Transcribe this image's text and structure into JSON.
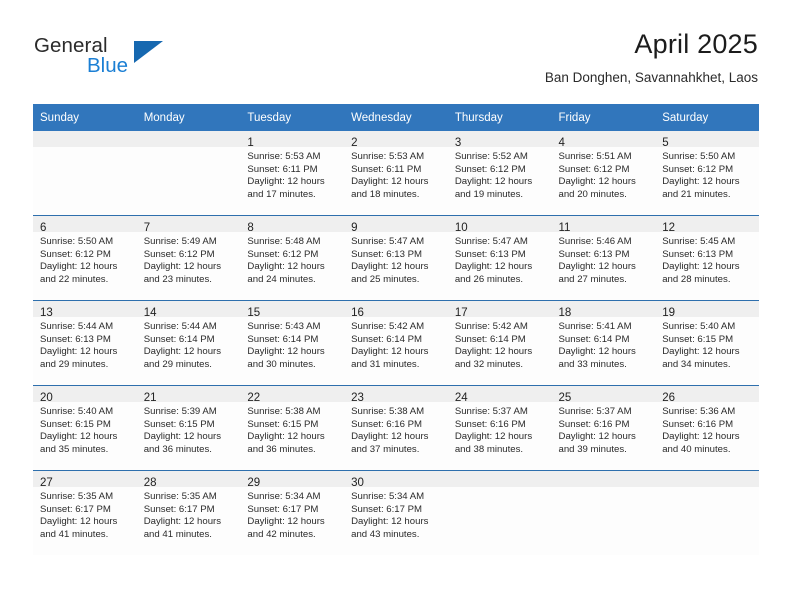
{
  "logo": {
    "word_one": "General",
    "word_two": "Blue",
    "flag_icon": "blue-triangle-flag-icon"
  },
  "header": {
    "title": "April 2025",
    "subtitle": "Ban Donghen, Savannahkhet, Laos"
  },
  "colors": {
    "header_blue": "#3176bc",
    "divider_blue": "#2e6fad",
    "daynum_band": "#efefef",
    "logo_blue": "#1b7fd4",
    "logo_flag": "#1668b0"
  },
  "calendar": {
    "weekday_headers": [
      "Sunday",
      "Monday",
      "Tuesday",
      "Wednesday",
      "Thursday",
      "Friday",
      "Saturday"
    ],
    "weeks": [
      [
        {
          "day": "",
          "sunrise": "",
          "sunset": "",
          "daylight_line1": "",
          "daylight_line2": ""
        },
        {
          "day": "",
          "sunrise": "",
          "sunset": "",
          "daylight_line1": "",
          "daylight_line2": ""
        },
        {
          "day": "1",
          "sunrise": "Sunrise: 5:53 AM",
          "sunset": "Sunset: 6:11 PM",
          "daylight_line1": "Daylight: 12 hours",
          "daylight_line2": "and 17 minutes."
        },
        {
          "day": "2",
          "sunrise": "Sunrise: 5:53 AM",
          "sunset": "Sunset: 6:11 PM",
          "daylight_line1": "Daylight: 12 hours",
          "daylight_line2": "and 18 minutes."
        },
        {
          "day": "3",
          "sunrise": "Sunrise: 5:52 AM",
          "sunset": "Sunset: 6:12 PM",
          "daylight_line1": "Daylight: 12 hours",
          "daylight_line2": "and 19 minutes."
        },
        {
          "day": "4",
          "sunrise": "Sunrise: 5:51 AM",
          "sunset": "Sunset: 6:12 PM",
          "daylight_line1": "Daylight: 12 hours",
          "daylight_line2": "and 20 minutes."
        },
        {
          "day": "5",
          "sunrise": "Sunrise: 5:50 AM",
          "sunset": "Sunset: 6:12 PM",
          "daylight_line1": "Daylight: 12 hours",
          "daylight_line2": "and 21 minutes."
        }
      ],
      [
        {
          "day": "6",
          "sunrise": "Sunrise: 5:50 AM",
          "sunset": "Sunset: 6:12 PM",
          "daylight_line1": "Daylight: 12 hours",
          "daylight_line2": "and 22 minutes."
        },
        {
          "day": "7",
          "sunrise": "Sunrise: 5:49 AM",
          "sunset": "Sunset: 6:12 PM",
          "daylight_line1": "Daylight: 12 hours",
          "daylight_line2": "and 23 minutes."
        },
        {
          "day": "8",
          "sunrise": "Sunrise: 5:48 AM",
          "sunset": "Sunset: 6:12 PM",
          "daylight_line1": "Daylight: 12 hours",
          "daylight_line2": "and 24 minutes."
        },
        {
          "day": "9",
          "sunrise": "Sunrise: 5:47 AM",
          "sunset": "Sunset: 6:13 PM",
          "daylight_line1": "Daylight: 12 hours",
          "daylight_line2": "and 25 minutes."
        },
        {
          "day": "10",
          "sunrise": "Sunrise: 5:47 AM",
          "sunset": "Sunset: 6:13 PM",
          "daylight_line1": "Daylight: 12 hours",
          "daylight_line2": "and 26 minutes."
        },
        {
          "day": "11",
          "sunrise": "Sunrise: 5:46 AM",
          "sunset": "Sunset: 6:13 PM",
          "daylight_line1": "Daylight: 12 hours",
          "daylight_line2": "and 27 minutes."
        },
        {
          "day": "12",
          "sunrise": "Sunrise: 5:45 AM",
          "sunset": "Sunset: 6:13 PM",
          "daylight_line1": "Daylight: 12 hours",
          "daylight_line2": "and 28 minutes."
        }
      ],
      [
        {
          "day": "13",
          "sunrise": "Sunrise: 5:44 AM",
          "sunset": "Sunset: 6:13 PM",
          "daylight_line1": "Daylight: 12 hours",
          "daylight_line2": "and 29 minutes."
        },
        {
          "day": "14",
          "sunrise": "Sunrise: 5:44 AM",
          "sunset": "Sunset: 6:14 PM",
          "daylight_line1": "Daylight: 12 hours",
          "daylight_line2": "and 29 minutes."
        },
        {
          "day": "15",
          "sunrise": "Sunrise: 5:43 AM",
          "sunset": "Sunset: 6:14 PM",
          "daylight_line1": "Daylight: 12 hours",
          "daylight_line2": "and 30 minutes."
        },
        {
          "day": "16",
          "sunrise": "Sunrise: 5:42 AM",
          "sunset": "Sunset: 6:14 PM",
          "daylight_line1": "Daylight: 12 hours",
          "daylight_line2": "and 31 minutes."
        },
        {
          "day": "17",
          "sunrise": "Sunrise: 5:42 AM",
          "sunset": "Sunset: 6:14 PM",
          "daylight_line1": "Daylight: 12 hours",
          "daylight_line2": "and 32 minutes."
        },
        {
          "day": "18",
          "sunrise": "Sunrise: 5:41 AM",
          "sunset": "Sunset: 6:14 PM",
          "daylight_line1": "Daylight: 12 hours",
          "daylight_line2": "and 33 minutes."
        },
        {
          "day": "19",
          "sunrise": "Sunrise: 5:40 AM",
          "sunset": "Sunset: 6:15 PM",
          "daylight_line1": "Daylight: 12 hours",
          "daylight_line2": "and 34 minutes."
        }
      ],
      [
        {
          "day": "20",
          "sunrise": "Sunrise: 5:40 AM",
          "sunset": "Sunset: 6:15 PM",
          "daylight_line1": "Daylight: 12 hours",
          "daylight_line2": "and 35 minutes."
        },
        {
          "day": "21",
          "sunrise": "Sunrise: 5:39 AM",
          "sunset": "Sunset: 6:15 PM",
          "daylight_line1": "Daylight: 12 hours",
          "daylight_line2": "and 36 minutes."
        },
        {
          "day": "22",
          "sunrise": "Sunrise: 5:38 AM",
          "sunset": "Sunset: 6:15 PM",
          "daylight_line1": "Daylight: 12 hours",
          "daylight_line2": "and 36 minutes."
        },
        {
          "day": "23",
          "sunrise": "Sunrise: 5:38 AM",
          "sunset": "Sunset: 6:16 PM",
          "daylight_line1": "Daylight: 12 hours",
          "daylight_line2": "and 37 minutes."
        },
        {
          "day": "24",
          "sunrise": "Sunrise: 5:37 AM",
          "sunset": "Sunset: 6:16 PM",
          "daylight_line1": "Daylight: 12 hours",
          "daylight_line2": "and 38 minutes."
        },
        {
          "day": "25",
          "sunrise": "Sunrise: 5:37 AM",
          "sunset": "Sunset: 6:16 PM",
          "daylight_line1": "Daylight: 12 hours",
          "daylight_line2": "and 39 minutes."
        },
        {
          "day": "26",
          "sunrise": "Sunrise: 5:36 AM",
          "sunset": "Sunset: 6:16 PM",
          "daylight_line1": "Daylight: 12 hours",
          "daylight_line2": "and 40 minutes."
        }
      ],
      [
        {
          "day": "27",
          "sunrise": "Sunrise: 5:35 AM",
          "sunset": "Sunset: 6:17 PM",
          "daylight_line1": "Daylight: 12 hours",
          "daylight_line2": "and 41 minutes."
        },
        {
          "day": "28",
          "sunrise": "Sunrise: 5:35 AM",
          "sunset": "Sunset: 6:17 PM",
          "daylight_line1": "Daylight: 12 hours",
          "daylight_line2": "and 41 minutes."
        },
        {
          "day": "29",
          "sunrise": "Sunrise: 5:34 AM",
          "sunset": "Sunset: 6:17 PM",
          "daylight_line1": "Daylight: 12 hours",
          "daylight_line2": "and 42 minutes."
        },
        {
          "day": "30",
          "sunrise": "Sunrise: 5:34 AM",
          "sunset": "Sunset: 6:17 PM",
          "daylight_line1": "Daylight: 12 hours",
          "daylight_line2": "and 43 minutes."
        },
        {
          "day": "",
          "sunrise": "",
          "sunset": "",
          "daylight_line1": "",
          "daylight_line2": ""
        },
        {
          "day": "",
          "sunrise": "",
          "sunset": "",
          "daylight_line1": "",
          "daylight_line2": ""
        },
        {
          "day": "",
          "sunrise": "",
          "sunset": "",
          "daylight_line1": "",
          "daylight_line2": ""
        }
      ]
    ]
  }
}
